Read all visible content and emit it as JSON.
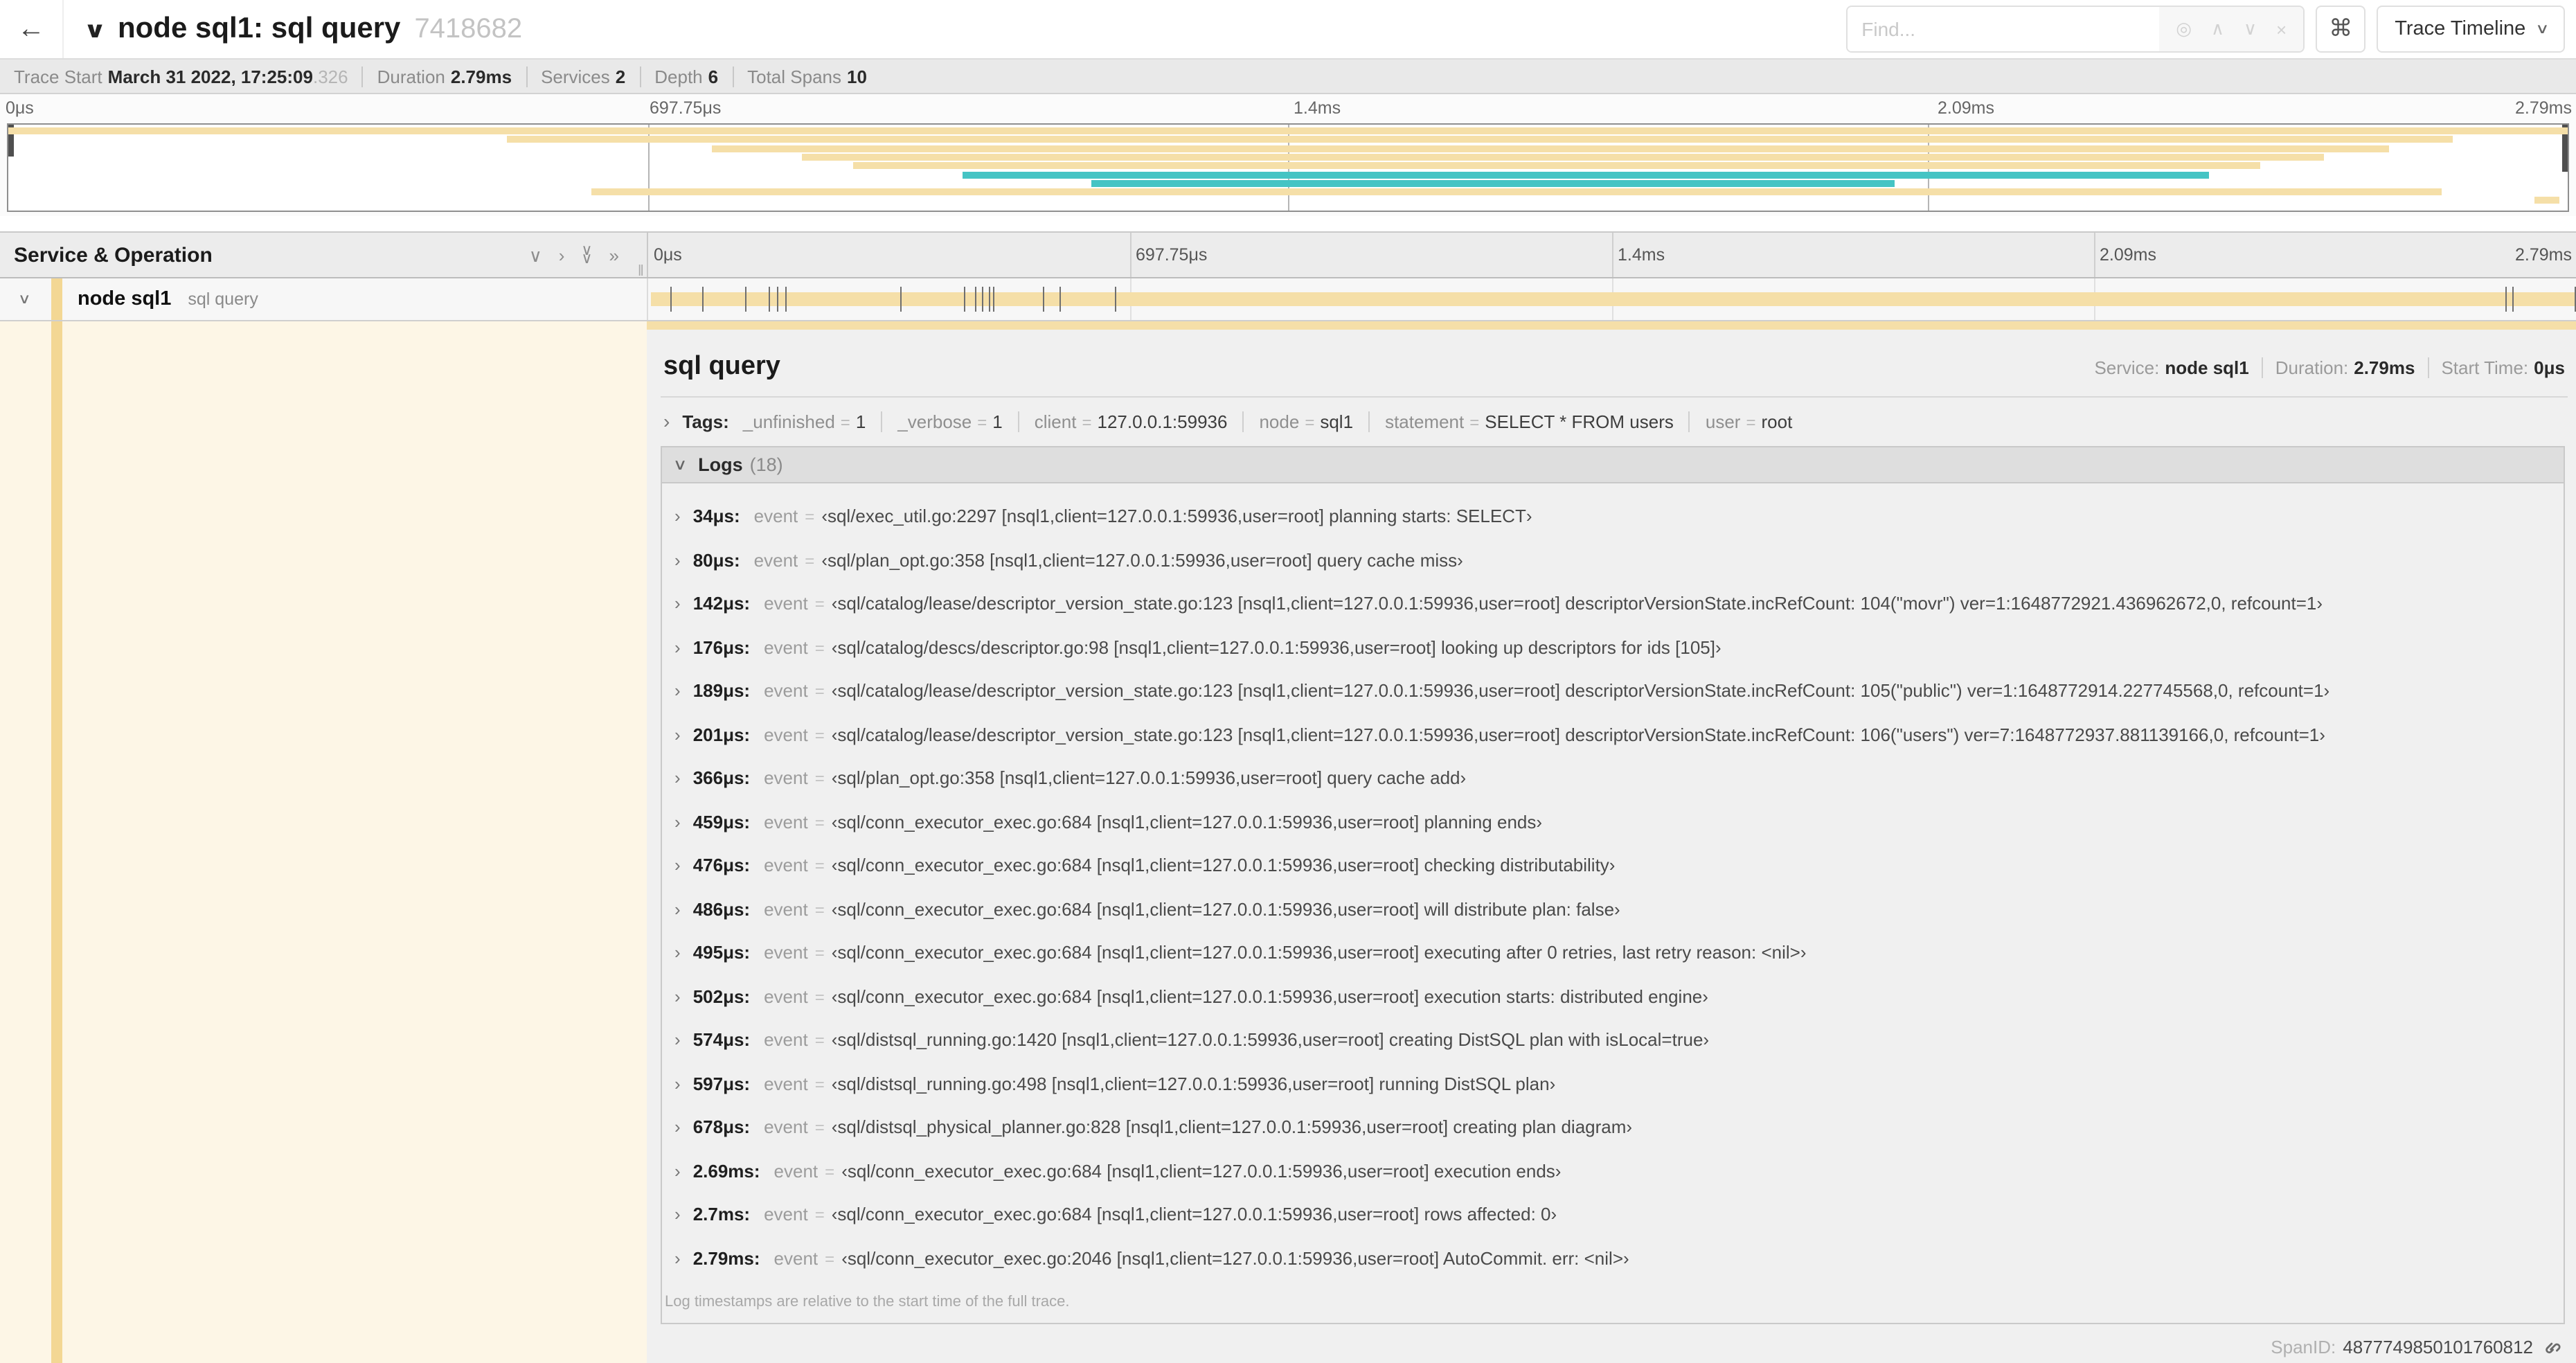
{
  "header": {
    "title": "node sql1: sql query",
    "trace_id": "7418682",
    "find": {
      "placeholder": "Find..."
    },
    "view_selector": "Trace Timeline"
  },
  "glyphs": {
    "back": "←",
    "chevron_down": "∨",
    "chevron_up": "∧",
    "chevron_right": "›",
    "double_chevron_right": "»",
    "locate": "◎",
    "close": "×",
    "command": "⌘",
    "grip": "‖"
  },
  "trace_info": {
    "items": [
      {
        "label": "Trace Start",
        "value": "March 31 2022, 17:25:09",
        "suffix": ".326"
      },
      {
        "label": "Duration",
        "value": "2.79ms",
        "suffix": ""
      },
      {
        "label": "Services",
        "value": "2",
        "suffix": ""
      },
      {
        "label": "Depth",
        "value": "6",
        "suffix": ""
      },
      {
        "label": "Total Spans",
        "value": "10",
        "suffix": ""
      }
    ]
  },
  "timeline": {
    "ticks": [
      "0μs",
      "697.75μs",
      "1.4ms",
      "2.09ms",
      "2.79ms"
    ],
    "total_duration_us": 2790,
    "minimap_spans": [
      {
        "start": 0,
        "end": 1,
        "color": "tan"
      },
      {
        "start": 0.195,
        "end": 0.955,
        "color": "tan"
      },
      {
        "start": 0.275,
        "end": 0.93,
        "color": "tan"
      },
      {
        "start": 0.31,
        "end": 0.905,
        "color": "tan"
      },
      {
        "start": 0.33,
        "end": 0.88,
        "color": "tan"
      },
      {
        "start": 0.373,
        "end": 0.86,
        "color": "teal"
      },
      {
        "start": 0.423,
        "end": 0.737,
        "color": "teal"
      },
      {
        "start": 0.228,
        "end": 0.951,
        "color": "tan"
      },
      {
        "start": 0.987,
        "end": 0.997,
        "color": "tan"
      }
    ]
  },
  "span_table": {
    "header_title": "Service & Operation",
    "row": {
      "service": "node sql1",
      "operation": "sql query",
      "log_marker_times_us": [
        34,
        80,
        142,
        176,
        189,
        201,
        366,
        459,
        476,
        486,
        495,
        502,
        574,
        597,
        678,
        2690,
        2700,
        2790
      ]
    }
  },
  "detail": {
    "title": "sql query",
    "summary": [
      {
        "label": "Service:",
        "value": "node sql1"
      },
      {
        "label": "Duration:",
        "value": "2.79ms"
      },
      {
        "label": "Start Time:",
        "value": "0μs"
      }
    ],
    "tags_label": "Tags:",
    "tags": [
      {
        "key": "_unfinished",
        "value": "1"
      },
      {
        "key": "_verbose",
        "value": "1"
      },
      {
        "key": "client",
        "value": "127.0.0.1:59936"
      },
      {
        "key": "node",
        "value": "sql1"
      },
      {
        "key": "statement",
        "value": "SELECT * FROM users"
      },
      {
        "key": "user",
        "value": "root"
      }
    ],
    "logs_label": "Logs",
    "logs_count": "(18)",
    "log_field_key": "event",
    "logs": [
      {
        "time": "34μs:",
        "value": "‹sql/exec_util.go:2297 [nsql1,client=127.0.0.1:59936,user=root] planning starts: SELECT›"
      },
      {
        "time": "80μs:",
        "value": "‹sql/plan_opt.go:358 [nsql1,client=127.0.0.1:59936,user=root] query cache miss›"
      },
      {
        "time": "142μs:",
        "value": "‹sql/catalog/lease/descriptor_version_state.go:123 [nsql1,client=127.0.0.1:59936,user=root] descriptorVersionState.incRefCount: 104(\"movr\") ver=1:1648772921.436962672,0, refcount=1›"
      },
      {
        "time": "176μs:",
        "value": "‹sql/catalog/descs/descriptor.go:98 [nsql1,client=127.0.0.1:59936,user=root] looking up descriptors for ids [105]›"
      },
      {
        "time": "189μs:",
        "value": "‹sql/catalog/lease/descriptor_version_state.go:123 [nsql1,client=127.0.0.1:59936,user=root] descriptorVersionState.incRefCount: 105(\"public\") ver=1:1648772914.227745568,0, refcount=1›"
      },
      {
        "time": "201μs:",
        "value": "‹sql/catalog/lease/descriptor_version_state.go:123 [nsql1,client=127.0.0.1:59936,user=root] descriptorVersionState.incRefCount: 106(\"users\") ver=7:1648772937.881139166,0, refcount=1›"
      },
      {
        "time": "366μs:",
        "value": "‹sql/plan_opt.go:358 [nsql1,client=127.0.0.1:59936,user=root] query cache add›"
      },
      {
        "time": "459μs:",
        "value": "‹sql/conn_executor_exec.go:684 [nsql1,client=127.0.0.1:59936,user=root] planning ends›"
      },
      {
        "time": "476μs:",
        "value": "‹sql/conn_executor_exec.go:684 [nsql1,client=127.0.0.1:59936,user=root] checking distributability›"
      },
      {
        "time": "486μs:",
        "value": "‹sql/conn_executor_exec.go:684 [nsql1,client=127.0.0.1:59936,user=root] will distribute plan: false›"
      },
      {
        "time": "495μs:",
        "value": "‹sql/conn_executor_exec.go:684 [nsql1,client=127.0.0.1:59936,user=root] executing after 0 retries, last retry reason: <nil>›"
      },
      {
        "time": "502μs:",
        "value": "‹sql/conn_executor_exec.go:684 [nsql1,client=127.0.0.1:59936,user=root] execution starts: distributed engine›"
      },
      {
        "time": "574μs:",
        "value": "‹sql/distsql_running.go:1420 [nsql1,client=127.0.0.1:59936,user=root] creating DistSQL plan with isLocal=true›"
      },
      {
        "time": "597μs:",
        "value": "‹sql/distsql_running.go:498 [nsql1,client=127.0.0.1:59936,user=root] running DistSQL plan›"
      },
      {
        "time": "678μs:",
        "value": "‹sql/distsql_physical_planner.go:828 [nsql1,client=127.0.0.1:59936,user=root] creating plan diagram›"
      },
      {
        "time": "2.69ms:",
        "value": "‹sql/conn_executor_exec.go:684 [nsql1,client=127.0.0.1:59936,user=root] execution ends›"
      },
      {
        "time": "2.7ms:",
        "value": "‹sql/conn_executor_exec.go:684 [nsql1,client=127.0.0.1:59936,user=root] rows affected: 0›"
      },
      {
        "time": "2.79ms:",
        "value": "‹sql/conn_executor_exec.go:2046 [nsql1,client=127.0.0.1:59936,user=root] AutoCommit. err: <nil>›"
      }
    ],
    "logs_footer": "Log timestamps are relative to the start time of the full trace.",
    "span_id_label": "SpanID:",
    "span_id": "4877749850101760812"
  },
  "colors": {
    "span_tan": "#f5dfa8",
    "span_teal": "#45c4c4",
    "accent_stripe": "#f3d794",
    "detail_left_bg": "#fdf6e6"
  }
}
